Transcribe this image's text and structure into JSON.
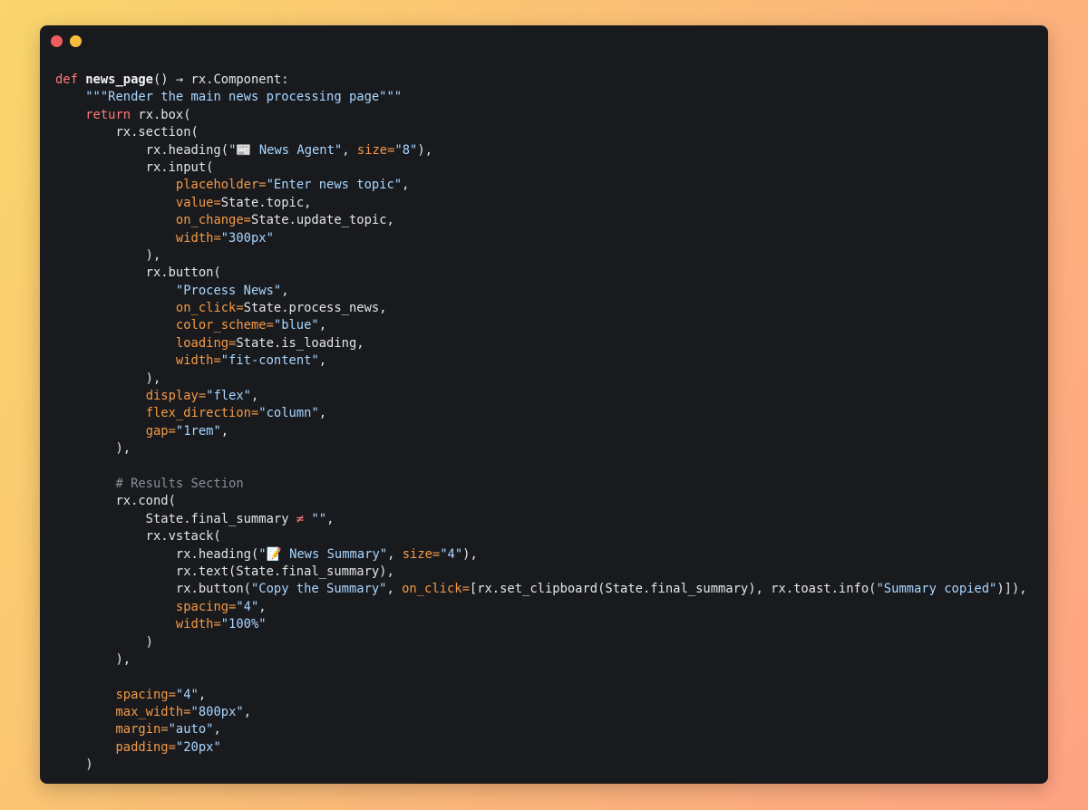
{
  "window": {
    "controls": [
      {
        "name": "close",
        "color": "#ee5d5d"
      },
      {
        "name": "minimize",
        "color": "#f6be3f"
      }
    ]
  },
  "colors": {
    "background_start": "#f9d56b",
    "background_end": "#ffa383",
    "editor_bg": "#191a1e",
    "keyword": "#ff7a7a",
    "string": "#a8d6ff",
    "param": "#f39a45",
    "comment": "#8a8f98",
    "text": "#e3e5ea"
  },
  "code_lines": [
    [
      {
        "t": "keyword",
        "v": "def "
      },
      {
        "t": "func",
        "v": "news_page"
      },
      {
        "t": "plain",
        "v": "() → rx.Component:"
      }
    ],
    [
      {
        "t": "plain",
        "v": "    "
      },
      {
        "t": "string",
        "v": "\"\"\"Render the main news processing page\"\"\""
      }
    ],
    [
      {
        "t": "plain",
        "v": "    "
      },
      {
        "t": "keyword",
        "v": "return "
      },
      {
        "t": "plain",
        "v": "rx.box("
      }
    ],
    [
      {
        "t": "plain",
        "v": "        rx.section("
      }
    ],
    [
      {
        "t": "plain",
        "v": "            rx.heading("
      },
      {
        "t": "string",
        "v": "\"📰 News Agent\""
      },
      {
        "t": "plain",
        "v": ", "
      },
      {
        "t": "param",
        "v": "size="
      },
      {
        "t": "string",
        "v": "\"8\""
      },
      {
        "t": "plain",
        "v": "),"
      }
    ],
    [
      {
        "t": "plain",
        "v": "            rx.input("
      }
    ],
    [
      {
        "t": "plain",
        "v": "                "
      },
      {
        "t": "param",
        "v": "placeholder="
      },
      {
        "t": "string",
        "v": "\"Enter news topic\""
      },
      {
        "t": "plain",
        "v": ","
      }
    ],
    [
      {
        "t": "plain",
        "v": "                "
      },
      {
        "t": "param",
        "v": "value="
      },
      {
        "t": "plain",
        "v": "State.topic,"
      }
    ],
    [
      {
        "t": "plain",
        "v": "                "
      },
      {
        "t": "param",
        "v": "on_change="
      },
      {
        "t": "plain",
        "v": "State.update_topic,"
      }
    ],
    [
      {
        "t": "plain",
        "v": "                "
      },
      {
        "t": "param",
        "v": "width="
      },
      {
        "t": "string",
        "v": "\"300px\""
      }
    ],
    [
      {
        "t": "plain",
        "v": "            ),"
      }
    ],
    [
      {
        "t": "plain",
        "v": "            rx.button("
      }
    ],
    [
      {
        "t": "plain",
        "v": "                "
      },
      {
        "t": "string",
        "v": "\"Process News\""
      },
      {
        "t": "plain",
        "v": ","
      }
    ],
    [
      {
        "t": "plain",
        "v": "                "
      },
      {
        "t": "param",
        "v": "on_click="
      },
      {
        "t": "plain",
        "v": "State.process_news,"
      }
    ],
    [
      {
        "t": "plain",
        "v": "                "
      },
      {
        "t": "param",
        "v": "color_scheme="
      },
      {
        "t": "string",
        "v": "\"blue\""
      },
      {
        "t": "plain",
        "v": ","
      }
    ],
    [
      {
        "t": "plain",
        "v": "                "
      },
      {
        "t": "param",
        "v": "loading="
      },
      {
        "t": "plain",
        "v": "State.is_loading,"
      }
    ],
    [
      {
        "t": "plain",
        "v": "                "
      },
      {
        "t": "param",
        "v": "width="
      },
      {
        "t": "string",
        "v": "\"fit-content\""
      },
      {
        "t": "plain",
        "v": ","
      }
    ],
    [
      {
        "t": "plain",
        "v": "            ),"
      }
    ],
    [
      {
        "t": "plain",
        "v": "            "
      },
      {
        "t": "param",
        "v": "display="
      },
      {
        "t": "string",
        "v": "\"flex\""
      },
      {
        "t": "plain",
        "v": ","
      }
    ],
    [
      {
        "t": "plain",
        "v": "            "
      },
      {
        "t": "param",
        "v": "flex_direction="
      },
      {
        "t": "string",
        "v": "\"column\""
      },
      {
        "t": "plain",
        "v": ","
      }
    ],
    [
      {
        "t": "plain",
        "v": "            "
      },
      {
        "t": "param",
        "v": "gap="
      },
      {
        "t": "string",
        "v": "\"1rem\""
      },
      {
        "t": "plain",
        "v": ","
      }
    ],
    [
      {
        "t": "plain",
        "v": "        ),"
      }
    ],
    [],
    [
      {
        "t": "plain",
        "v": "        "
      },
      {
        "t": "comment",
        "v": "# Results Section"
      }
    ],
    [
      {
        "t": "plain",
        "v": "        rx.cond("
      }
    ],
    [
      {
        "t": "plain",
        "v": "            State.final_summary "
      },
      {
        "t": "op",
        "v": "≠"
      },
      {
        "t": "plain",
        "v": " "
      },
      {
        "t": "string",
        "v": "\"\""
      },
      {
        "t": "plain",
        "v": ","
      }
    ],
    [
      {
        "t": "plain",
        "v": "            rx.vstack("
      }
    ],
    [
      {
        "t": "plain",
        "v": "                rx.heading("
      },
      {
        "t": "string",
        "v": "\"📝 News Summary\""
      },
      {
        "t": "plain",
        "v": ", "
      },
      {
        "t": "param",
        "v": "size="
      },
      {
        "t": "string",
        "v": "\"4\""
      },
      {
        "t": "plain",
        "v": "),"
      }
    ],
    [
      {
        "t": "plain",
        "v": "                rx.text(State.final_summary),"
      }
    ],
    [
      {
        "t": "plain",
        "v": "                rx.button("
      },
      {
        "t": "string",
        "v": "\"Copy the Summary\""
      },
      {
        "t": "plain",
        "v": ", "
      },
      {
        "t": "param",
        "v": "on_click="
      },
      {
        "t": "plain",
        "v": "[rx.set_clipboard(State.final_summary), rx.toast.info("
      },
      {
        "t": "string",
        "v": "\"Summary copied\""
      },
      {
        "t": "plain",
        "v": ")]),"
      }
    ],
    [
      {
        "t": "plain",
        "v": "                "
      },
      {
        "t": "param",
        "v": "spacing="
      },
      {
        "t": "string",
        "v": "\"4\""
      },
      {
        "t": "plain",
        "v": ","
      }
    ],
    [
      {
        "t": "plain",
        "v": "                "
      },
      {
        "t": "param",
        "v": "width="
      },
      {
        "t": "string",
        "v": "\"100%\""
      }
    ],
    [
      {
        "t": "plain",
        "v": "            )"
      }
    ],
    [
      {
        "t": "plain",
        "v": "        ),"
      }
    ],
    [],
    [
      {
        "t": "plain",
        "v": "        "
      },
      {
        "t": "param",
        "v": "spacing="
      },
      {
        "t": "string",
        "v": "\"4\""
      },
      {
        "t": "plain",
        "v": ","
      }
    ],
    [
      {
        "t": "plain",
        "v": "        "
      },
      {
        "t": "param",
        "v": "max_width="
      },
      {
        "t": "string",
        "v": "\"800px\""
      },
      {
        "t": "plain",
        "v": ","
      }
    ],
    [
      {
        "t": "plain",
        "v": "        "
      },
      {
        "t": "param",
        "v": "margin="
      },
      {
        "t": "string",
        "v": "\"auto\""
      },
      {
        "t": "plain",
        "v": ","
      }
    ],
    [
      {
        "t": "plain",
        "v": "        "
      },
      {
        "t": "param",
        "v": "padding="
      },
      {
        "t": "string",
        "v": "\"20px\""
      }
    ],
    [
      {
        "t": "plain",
        "v": "    )"
      }
    ]
  ]
}
